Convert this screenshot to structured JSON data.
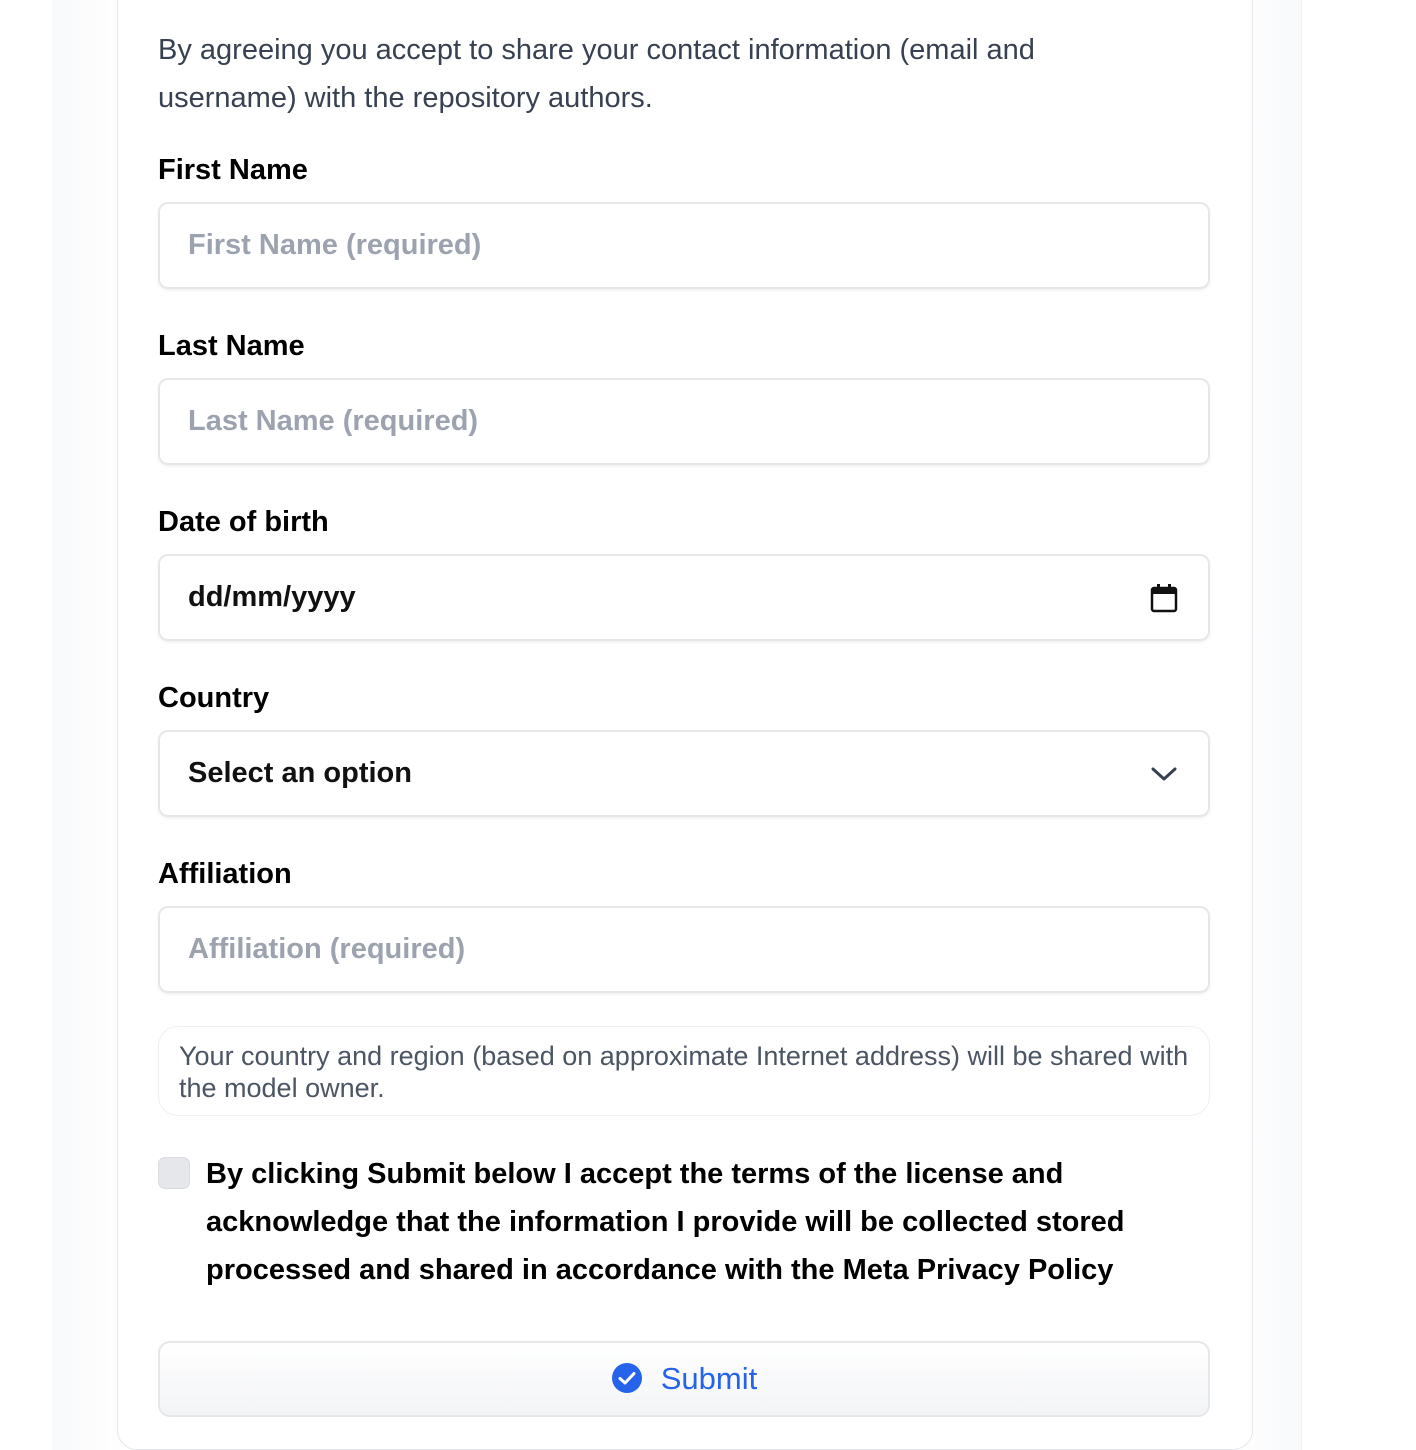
{
  "intro_text": "By agreeing you accept to share your contact information (email and username) with the repository authors.",
  "fields": {
    "first_name": {
      "label": "First Name",
      "placeholder": "First Name (required)"
    },
    "last_name": {
      "label": "Last Name",
      "placeholder": "Last Name (required)"
    },
    "date_of_birth": {
      "label": "Date of birth",
      "value": "dd/mm/yyyy",
      "icon": "calendar-icon"
    },
    "country": {
      "label": "Country",
      "value": "Select an option",
      "icon": "chevron-down-icon"
    },
    "affiliation": {
      "label": "Affiliation",
      "placeholder": "Affiliation (required)"
    }
  },
  "notice_text": "Your country and region (based on approximate Internet address) will be shared with the model owner.",
  "consent": {
    "checked": false,
    "label": "By clicking Submit below I accept the terms of the license and acknowledge that the information I provide will be collected stored processed and shared in accordance with the Meta Privacy Policy"
  },
  "submit": {
    "label": "Submit",
    "icon": "check-circle-icon",
    "color": "#2563eb"
  },
  "colors": {
    "placeholder": "#9ca3af",
    "border": "#e5e7eb",
    "accent": "#2563eb"
  }
}
